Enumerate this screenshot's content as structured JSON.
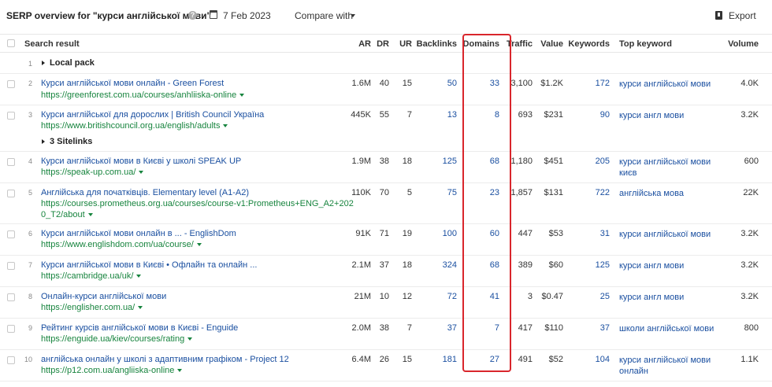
{
  "header": {
    "title": "SERP overview for \"курси англійської мови\"",
    "help_icon": "?",
    "date": "7 Feb 2023",
    "compare_label": "Compare with",
    "export_label": "Export"
  },
  "columns": [
    "Search result",
    "AR",
    "DR",
    "UR",
    "Backlinks",
    "Domains",
    "Traffic",
    "Value",
    "Keywords",
    "Top keyword",
    "Volume"
  ],
  "sections": {
    "local_pack": {
      "num": "1",
      "label": "Local pack"
    },
    "sitelinks": {
      "label": "3 Sitelinks"
    }
  },
  "rows": [
    {
      "num": "2",
      "title": "Курси англійської мови онлайн - Green Forest",
      "url": "https://greenforest.com.ua/courses/anhliiska-online",
      "ar": "1.6M",
      "dr": "40",
      "ur": "15",
      "backlinks": "50",
      "domains": "33",
      "traffic": "3,100",
      "value": "$1.2K",
      "keywords": "172",
      "top_keyword": "курси англійської мови",
      "volume": "4.0K"
    },
    {
      "num": "3",
      "title": "Курси англійської для дорослих | British Council Україна",
      "url": "https://www.britishcouncil.org.ua/english/adults",
      "ar": "445K",
      "dr": "55",
      "ur": "7",
      "backlinks": "13",
      "domains": "8",
      "traffic": "693",
      "value": "$231",
      "keywords": "90",
      "top_keyword": "курси англ мови",
      "volume": "3.2K"
    },
    {
      "num": "4",
      "title": "Курси англійської мови в Києві у школі SPEAK UP",
      "url": "https://speak-up.com.ua/",
      "ar": "1.9M",
      "dr": "38",
      "ur": "18",
      "backlinks": "125",
      "domains": "68",
      "traffic": "1,180",
      "value": "$451",
      "keywords": "205",
      "top_keyword": "курси англійської мови києв",
      "volume": "600"
    },
    {
      "num": "5",
      "title": "Англійська для початківців. Elementary level (A1-A2)",
      "url": "https://courses.prometheus.org.ua/courses/course-v1:Prometheus+ENG_A2+2020_T2/about",
      "url_line1": "https://courses.prometheus.org.ua/courses/course-v1:Prometheus+ENG_A2+202",
      "url_line2": "0_T2/about",
      "ar": "110K",
      "dr": "70",
      "ur": "5",
      "backlinks": "75",
      "domains": "23",
      "traffic": "1,857",
      "value": "$131",
      "keywords": "722",
      "top_keyword": "англійська мова",
      "volume": "22K"
    },
    {
      "num": "6",
      "title": "Курси англійської мови онлайн в ... - EnglishDom",
      "url": "https://www.englishdom.com/ua/course/",
      "ar": "91K",
      "dr": "71",
      "ur": "19",
      "backlinks": "100",
      "domains": "60",
      "traffic": "447",
      "value": "$53",
      "keywords": "31",
      "top_keyword": "курси англійської мови",
      "volume": "3.2K"
    },
    {
      "num": "7",
      "title": "Курси англійської мови в Києві • Офлайн та онлайн ...",
      "url": "https://cambridge.ua/uk/",
      "ar": "2.1M",
      "dr": "37",
      "ur": "18",
      "backlinks": "324",
      "domains": "68",
      "traffic": "389",
      "value": "$60",
      "keywords": "125",
      "top_keyword": "курси англ мови",
      "volume": "3.2K"
    },
    {
      "num": "8",
      "title": "Онлайн-курси англійської мови",
      "url": "https://englisher.com.ua/",
      "ar": "21M",
      "dr": "10",
      "ur": "12",
      "backlinks": "72",
      "domains": "41",
      "traffic": "3",
      "value": "$0.47",
      "keywords": "25",
      "top_keyword": "курси англ мови",
      "volume": "3.2K"
    },
    {
      "num": "9",
      "title": "Рейтинг курсів англійської мови в Києві - Enguide",
      "url": "https://enguide.ua/kiev/courses/rating",
      "ar": "2.0M",
      "dr": "38",
      "ur": "7",
      "backlinks": "37",
      "domains": "7",
      "traffic": "417",
      "value": "$110",
      "keywords": "37",
      "top_keyword": "школи англійської мови",
      "volume": "800"
    },
    {
      "num": "10",
      "title": "англійська онлайн у школі з адаптивним графіком - Project 12",
      "url": "https://p12.com.ua/angliiska-online",
      "ar": "6.4M",
      "dr": "26",
      "ur": "15",
      "backlinks": "181",
      "domains": "27",
      "traffic": "491",
      "value": "$52",
      "keywords": "104",
      "top_keyword": "курси англійської мови онлайн",
      "volume": "1.1K"
    }
  ],
  "colors": {
    "link": "#1a4fa0",
    "url": "#17843e",
    "highlight": "#d9262c"
  }
}
